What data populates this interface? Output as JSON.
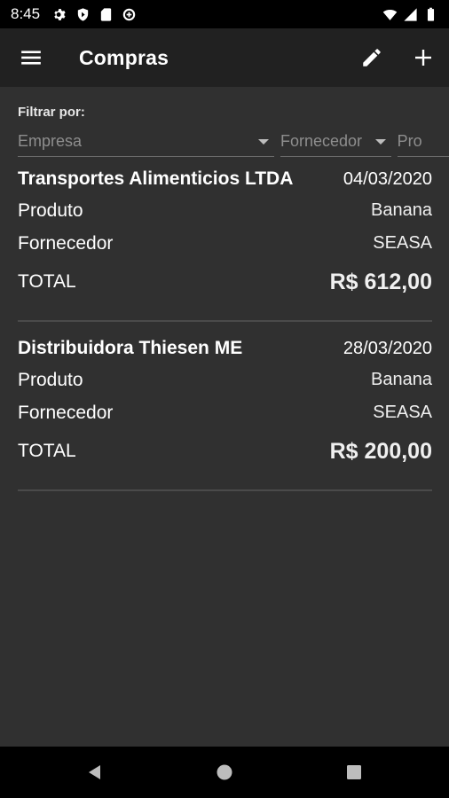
{
  "status_bar": {
    "time": "8:45",
    "icons": [
      "gear-icon",
      "shield-icon",
      "sd-card-icon",
      "data-saver-icon"
    ],
    "right_icons": [
      "wifi-icon",
      "signal-icon",
      "battery-icon"
    ]
  },
  "app_bar": {
    "title": "Compras",
    "actions": [
      "edit-icon",
      "add-icon"
    ]
  },
  "filter": {
    "label": "Filtrar por:",
    "empresa_placeholder": "Empresa",
    "fornecedor_placeholder": "Fornecedor",
    "produto_placeholder": "Pro"
  },
  "purchases": [
    {
      "company": "Transportes Alimenticios LTDA",
      "date": "04/03/2020",
      "product_label": "Produto",
      "product": "Banana",
      "supplier_label": "Fornecedor",
      "supplier": "SEASA",
      "total_label": "TOTAL",
      "total": "R$ 612,00"
    },
    {
      "company": "Distribuidora Thiesen ME",
      "date": "28/03/2020",
      "product_label": "Produto",
      "product": "Banana",
      "supplier_label": "Fornecedor",
      "supplier": "SEASA",
      "total_label": "TOTAL",
      "total": "R$ 200,00"
    }
  ],
  "colors": {
    "background": "#303030",
    "app_bar": "#212121",
    "divider": "#4a4a4a",
    "system_bars": "#000000"
  }
}
